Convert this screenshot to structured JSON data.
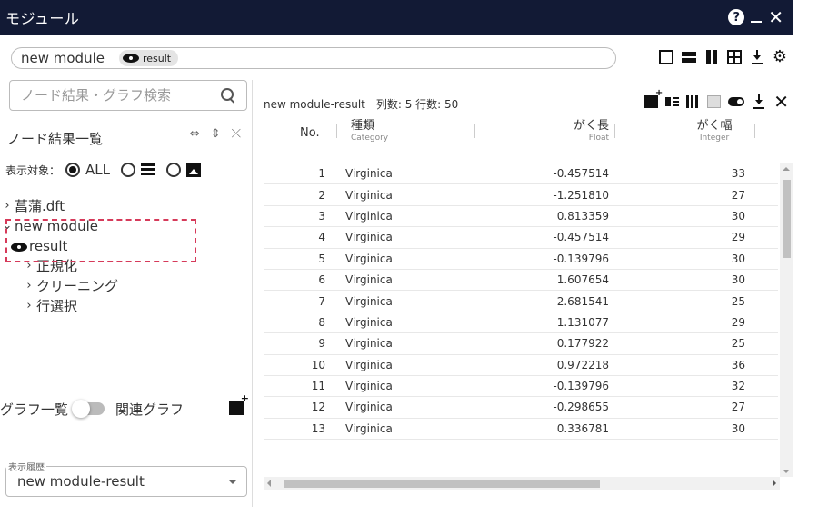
{
  "window": {
    "title": "モジュール",
    "help": "?"
  },
  "module": {
    "name": "new module",
    "chip_label": "result"
  },
  "left": {
    "search_placeholder": "ノード結果・グラフ検索",
    "node_list_title": "ノード結果一覧",
    "filter_label": "表示対象：",
    "filter_all": "ALL",
    "tree": [
      {
        "label": "菖蒲.dft",
        "expanded": false,
        "level": 1
      },
      {
        "label": "new module",
        "expanded": true,
        "level": 1
      },
      {
        "label": "result",
        "level": 1,
        "icon": "eye-icon"
      },
      {
        "label": "正規化",
        "expanded": false,
        "level": 2
      },
      {
        "label": "クリーニング",
        "expanded": false,
        "level": 2
      },
      {
        "label": "行選択",
        "expanded": false,
        "level": 2
      }
    ],
    "graph_list": "グラフ一覧",
    "related_graph": "関連グラフ",
    "history_legend": "表示履歴",
    "history_value": "new module-result"
  },
  "right": {
    "header": "new module-result　列数: 5 行数: 50",
    "columns": [
      {
        "label": "No.",
        "sub": ""
      },
      {
        "label": "種類",
        "sub": "Category"
      },
      {
        "label": "がく長",
        "sub": "Float"
      },
      {
        "label": "がく幅",
        "sub": "Integer"
      }
    ],
    "rows": [
      [
        "1",
        "Virginica",
        "-0.457514",
        "33"
      ],
      [
        "2",
        "Virginica",
        "-1.251810",
        "27"
      ],
      [
        "3",
        "Virginica",
        "0.813359",
        "30"
      ],
      [
        "4",
        "Virginica",
        "-0.457514",
        "29"
      ],
      [
        "5",
        "Virginica",
        "-0.139796",
        "30"
      ],
      [
        "6",
        "Virginica",
        "1.607654",
        "30"
      ],
      [
        "7",
        "Virginica",
        "-2.681541",
        "25"
      ],
      [
        "8",
        "Virginica",
        "1.131077",
        "29"
      ],
      [
        "9",
        "Virginica",
        "0.177922",
        "25"
      ],
      [
        "10",
        "Virginica",
        "0.972218",
        "36"
      ],
      [
        "11",
        "Virginica",
        "-0.139796",
        "32"
      ],
      [
        "12",
        "Virginica",
        "-0.298655",
        "27"
      ],
      [
        "13",
        "Virginica",
        "0.336781",
        "30"
      ]
    ]
  },
  "colors": {
    "titlebar": "#121a35",
    "highlight": "#d63a5a"
  }
}
